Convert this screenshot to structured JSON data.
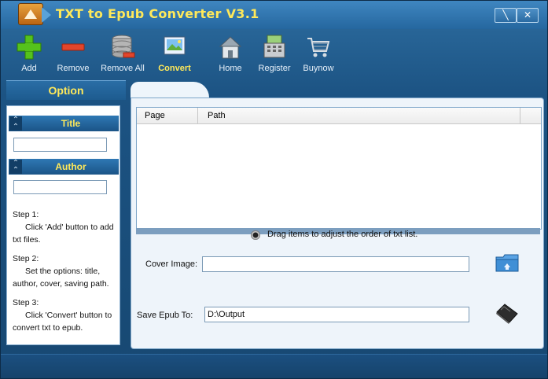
{
  "window": {
    "title": "TXT to Epub Converter V3.1"
  },
  "toolbar": {
    "add_label": "Add",
    "remove_label": "Remove",
    "remove_all_label": "Remove All",
    "convert_label": "Convert",
    "home_label": "Home",
    "register_label": "Register",
    "buynow_label": "Buynow"
  },
  "sidebar": {
    "header": "Option",
    "title_section": "Title",
    "author_section": "Author",
    "steps": [
      {
        "heading": "Step 1:",
        "body": "Click 'Add' button to add txt files."
      },
      {
        "heading": "Step 2:",
        "body": "Set the options: title, author, cover, saving path."
      },
      {
        "heading": "Step 3:",
        "body": "Click 'Convert' button to convert txt to epub."
      }
    ]
  },
  "main": {
    "columns": [
      "Page",
      "Path"
    ],
    "hint": "Drag items to  adjust the order of txt list.",
    "cover_label": "Cover Image:",
    "cover_value": "",
    "save_label": "Save  Epub  To:",
    "save_value": "D:\\Output"
  },
  "colors": {
    "accent_text": "#ffe95a",
    "window_blue": "#1c5383"
  }
}
